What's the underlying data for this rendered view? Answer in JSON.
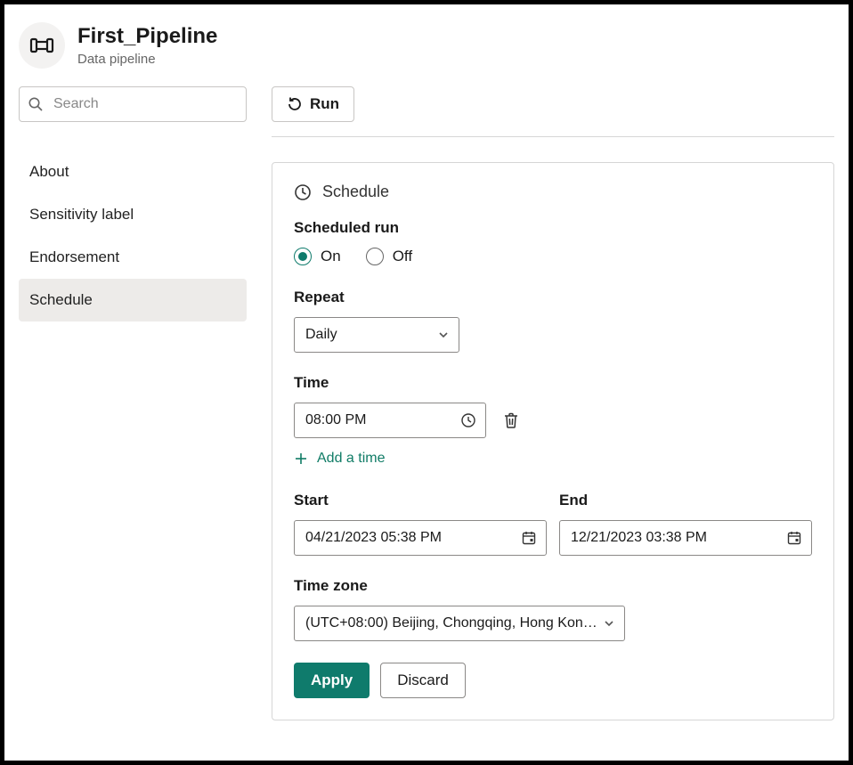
{
  "header": {
    "title": "First_Pipeline",
    "subtitle": "Data pipeline"
  },
  "sidebar": {
    "search_placeholder": "Search",
    "items": [
      {
        "label": "About",
        "active": false
      },
      {
        "label": "Sensitivity label",
        "active": false
      },
      {
        "label": "Endorsement",
        "active": false
      },
      {
        "label": "Schedule",
        "active": true
      }
    ]
  },
  "toolbar": {
    "run_label": "Run"
  },
  "panel": {
    "title": "Schedule",
    "scheduled_run": {
      "label": "Scheduled run",
      "on_label": "On",
      "off_label": "Off",
      "value": "on"
    },
    "repeat": {
      "label": "Repeat",
      "value": "Daily"
    },
    "time": {
      "label": "Time",
      "values": [
        "08:00 PM"
      ],
      "add_label": "Add a time"
    },
    "start": {
      "label": "Start",
      "value": "04/21/2023 05:38 PM"
    },
    "end": {
      "label": "End",
      "value": "12/21/2023 03:38 PM"
    },
    "timezone": {
      "label": "Time zone",
      "value": "(UTC+08:00) Beijing, Chongqing, Hong Kon…"
    },
    "actions": {
      "apply": "Apply",
      "discard": "Discard"
    }
  }
}
